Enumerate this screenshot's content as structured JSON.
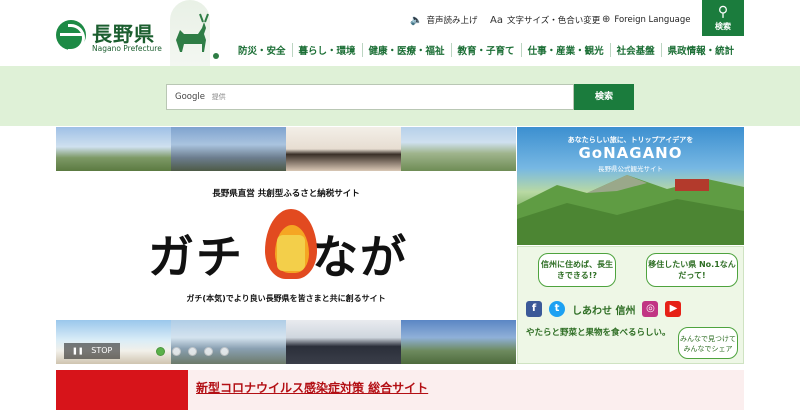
{
  "header": {
    "logo_jp": "長野県",
    "logo_en": "Nagano Prefecture",
    "utility": {
      "voice": "音声読み上げ",
      "size_color": "文字サイズ・色合い変更",
      "language": "Foreign Language"
    },
    "search_label": "検索"
  },
  "global_nav": [
    {
      "label": "防災・安全"
    },
    {
      "label": "暮らし・環境"
    },
    {
      "label": "健康・医療・福祉"
    },
    {
      "label": "教育・子育て"
    },
    {
      "label": "仕事・産業・観光"
    },
    {
      "label": "社会基盤"
    },
    {
      "label": "県政情報・統計"
    }
  ],
  "site_search": {
    "brand": "Google",
    "placeholder": "提供",
    "button": "検索"
  },
  "main_banner": {
    "subtitle": "長野県直営 共創型ふるさと納税サイト",
    "title_left": "ガチ",
    "title_right": "なが",
    "tagline": "ガチ(本気)でより良い長野県を皆さまと共に創るサイト",
    "stop_label": "STOP",
    "slide_count": 5,
    "active_slide": 0
  },
  "side_banners": {
    "gonagano": {
      "catch": "あなたらしい旅に、トリップアイデアを",
      "logo": "GoNAGANO",
      "sub": "長野県公式観光サイト"
    },
    "sns": {
      "bubble1": "信州に住めば、長生きできる!?",
      "bubble2": "移住したい県 No.1なんだって!",
      "slogan": "しあわせ 信州",
      "veg": "やたらと野菜と果物を食べるらしい。",
      "share": "みんなで見つけて みんなでシェア"
    }
  },
  "covid": {
    "link": "新型コロナウイルス感染症対策 総合サイト"
  },
  "colors": {
    "brand_green": "#1b7c3d",
    "nav_text": "#1b6e35",
    "band_bg": "#dff1d7",
    "alert_red": "#d7141a"
  }
}
